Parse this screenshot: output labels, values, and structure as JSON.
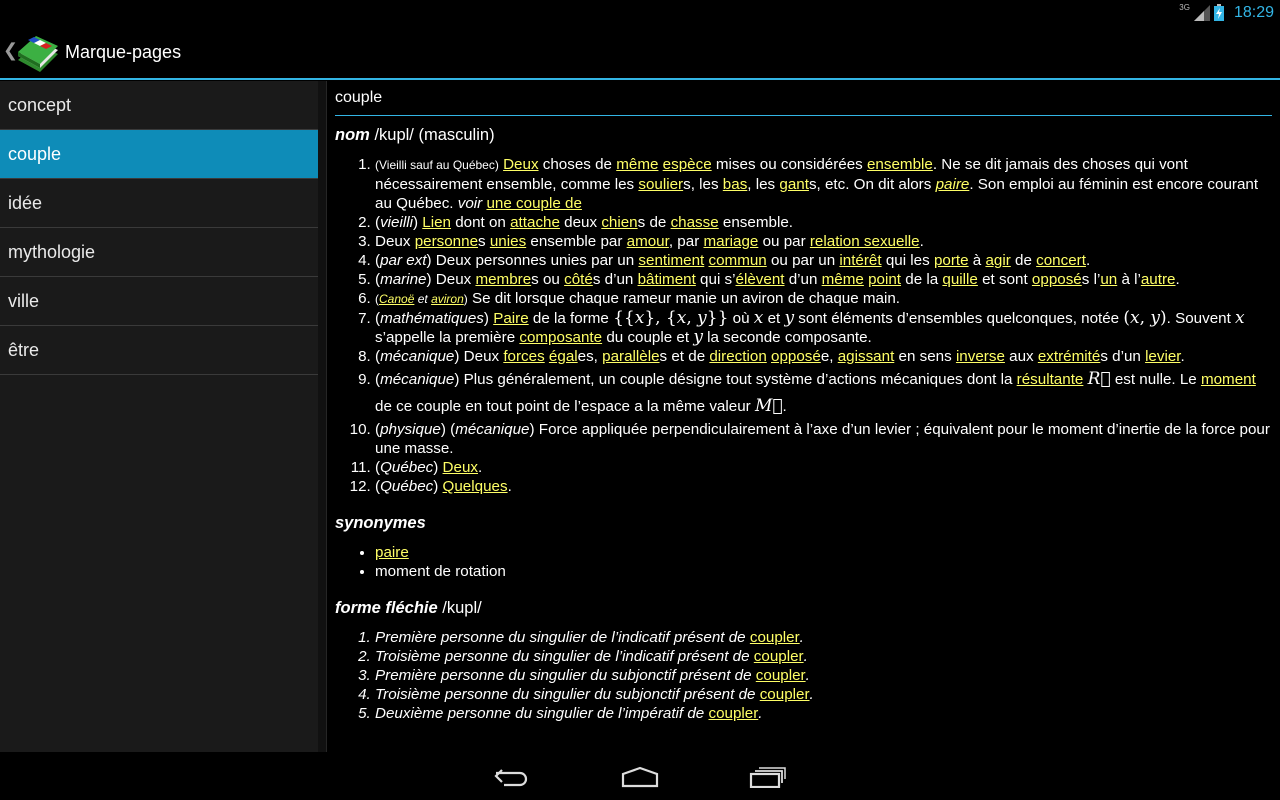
{
  "status_bar": {
    "network": "3G",
    "time": "18:29"
  },
  "action_bar": {
    "title": "Marque-pages"
  },
  "sidebar": {
    "items": [
      {
        "label": "concept"
      },
      {
        "label": "couple"
      },
      {
        "label": "idée"
      },
      {
        "label": "mythologie"
      },
      {
        "label": "ville"
      },
      {
        "label": "être"
      }
    ],
    "selected_index": 1
  },
  "entry": {
    "word": "couple",
    "pos": "nom",
    "pron": "/kupl/",
    "gender": "(masculin)",
    "synonyms_title": "synonymes",
    "synonyms": [
      "paire",
      "moment de rotation"
    ],
    "inflected_title": "forme fléchie",
    "inflected_pron": "/kupl/",
    "inflected": [
      {
        "text": "Première personne du singulier de l’indicatif présent de",
        "link": "coupler"
      },
      {
        "text": "Troisième personne du singulier de l’indicatif présent de",
        "link": "coupler"
      },
      {
        "text": "Première personne du singulier du subjonctif présent de",
        "link": "coupler"
      },
      {
        "text": "Troisième personne du singulier du subjonctif présent de",
        "link": "coupler"
      },
      {
        "text": "Deuxième personne du singulier de l’impératif de",
        "link": "coupler"
      }
    ]
  },
  "colors": {
    "accent": "#33b5e5",
    "selected": "#0e8cb8",
    "link": "#ffff66"
  },
  "icons": [
    "signal-icon",
    "battery-icon",
    "dictionary-book-icon",
    "back-icon",
    "home-icon",
    "recent-apps-icon"
  ]
}
